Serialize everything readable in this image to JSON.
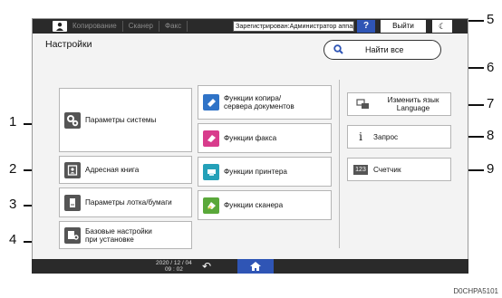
{
  "topbar": {
    "tabs": [
      "Копирование",
      "Сканер",
      "Факс"
    ],
    "status": "Зарегистрирован:Администратор аппарат",
    "help": "?",
    "logout": "Выйти",
    "moon": "☾"
  },
  "title": "Настройки",
  "search": {
    "label": "Найти все"
  },
  "buttons": {
    "system": "Параметры системы",
    "address": "Адресная книга",
    "tray": "Параметры лотка/бумаги",
    "basic1": "Базовые настройки",
    "basic2": "при установке",
    "copy1": "Функции копира/",
    "copy2": "сервера документов",
    "fax": "Функции факса",
    "printer": "Функции принтера",
    "scanner": "Функции сканера",
    "lang1": "Изменить язык",
    "lang2": "Language",
    "inquiry": "Запрос",
    "counter": "Счетчик"
  },
  "bottombar": {
    "date": "2020 / 12 / 04",
    "time": "09 : 02"
  },
  "callouts": [
    "1",
    "2",
    "3",
    "4",
    "5",
    "6",
    "7",
    "8",
    "9"
  ],
  "figure_code": "D0CHPA5101",
  "colors": {
    "accent": "#2f55b5",
    "bar": "#2a2a2a"
  }
}
